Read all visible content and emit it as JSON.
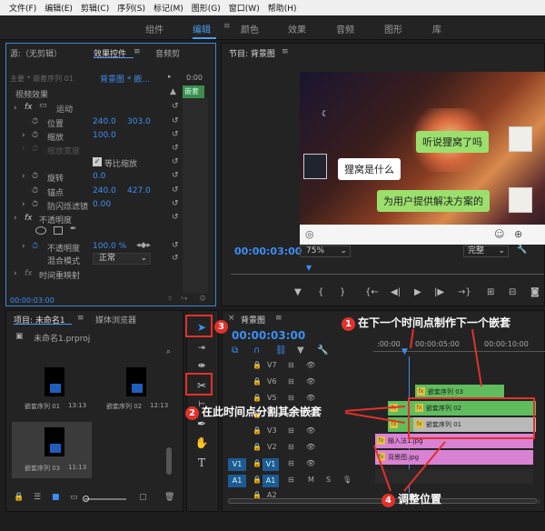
{
  "menu": [
    "文件(F)",
    "编辑(E)",
    "剪辑(C)",
    "序列(S)",
    "标记(M)",
    "图形(G)",
    "窗口(W)",
    "帮助(H)"
  ],
  "workspaces": [
    "组件",
    "编辑",
    "颜色",
    "效果",
    "音频",
    "图形",
    "库"
  ],
  "effects_panel": {
    "tab_source": "源:（无剪辑）",
    "tab_effects": "效果控件",
    "tab_audio": "音频剪",
    "source_label": "主要 * 嵌套序列 01",
    "sequence_label": "背景图 * 嵌...",
    "time_header": "0:00",
    "clip_label": "嵌套",
    "video_effects": "视频效果",
    "motion": "运动",
    "position_label": "位置",
    "position_x": "240.0",
    "position_y": "303.0",
    "scale_label": "缩放",
    "scale_value": "100.0",
    "scale_width_label": "缩放宽度",
    "uniform_scale_label": "等比缩放",
    "rotation_label": "旋转",
    "rotation_value": "0.0",
    "anchor_label": "锚点",
    "anchor_x": "240.0",
    "anchor_y": "427.0",
    "antiflicker_label": "防闪烁滤镜",
    "antiflicker_value": "0.00",
    "opacity_section": "不透明度",
    "opacity_label": "不透明度",
    "opacity_value": "100.0 %",
    "blend_label": "混合模式",
    "blend_value": "正常",
    "time_remap": "时间重映射",
    "timecode": "00:00:03:00"
  },
  "program": {
    "title": "节目: 背景图",
    "bubble1": "听说狸窝了吗",
    "bubble2": "狸窝是什么",
    "bubble3": "为用户提供解决方案的",
    "timecode": "00:00:03:00",
    "zoom": "75%",
    "quality": "完整"
  },
  "project": {
    "tab_project": "项目: 未命名1",
    "tab_media": "媒体浏览器",
    "filename": "未命名1.prproj",
    "items": [
      {
        "name": "嵌套序列 01",
        "dur": "13:13"
      },
      {
        "name": "嵌套序列 02",
        "dur": "12:13"
      },
      {
        "name": "嵌套序列 03",
        "dur": "11:13"
      }
    ]
  },
  "timeline": {
    "tab": "背景图",
    "timecode": "00:00:03:00",
    "ruler": [
      ":00:00",
      "00:00:05:00",
      "00:00:10:00"
    ],
    "video_tracks": [
      "V7",
      "V6",
      "V5",
      "V4",
      "V3",
      "V2",
      "V1"
    ],
    "audio_tracks": [
      "A1",
      "A2"
    ],
    "source_v": "V1",
    "source_a": "A1",
    "clips": {
      "c3": "嵌套序列 03",
      "c2": "嵌套序列 02",
      "c1": "嵌套序列 01",
      "img1": "输入法1.jpg",
      "bg": "背景图.jpg"
    }
  },
  "annotations": {
    "a1": "在下一个时间点制作下一个嵌套",
    "a2": "在此时间点分割其余嵌套",
    "a3": "3",
    "a4": "调整位置",
    "n1": "1",
    "n2": "2",
    "n4": "4"
  }
}
